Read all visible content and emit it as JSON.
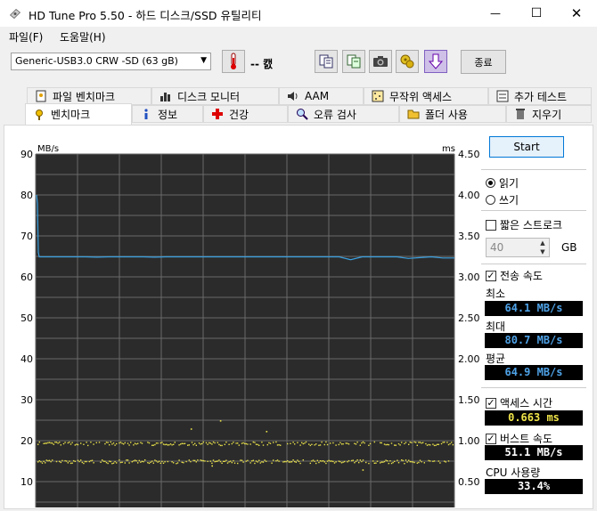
{
  "window": {
    "title": "HD Tune Pro 5.50 - 하드 디스크/SSD 유틸리티",
    "minimize": "—",
    "maximize": "☐",
    "close": "✕"
  },
  "menu": {
    "file": "파일(F)",
    "help": "도움말(H)"
  },
  "toolbar": {
    "drive": "Generic-USB3.0 CRW  -SD (63 gB)",
    "temperature": "-- 캜",
    "exit": "종료"
  },
  "tabs_top": [
    {
      "label": "파일 벤치마크",
      "icon": "file-benchmark-icon"
    },
    {
      "label": "디스크 모니터",
      "icon": "disk-monitor-icon"
    },
    {
      "label": "AAM",
      "icon": "speaker-icon"
    },
    {
      "label": "무작위 액세스",
      "icon": "random-access-icon"
    },
    {
      "label": "추가 테스트",
      "icon": "extra-tests-icon"
    }
  ],
  "tabs_bottom": [
    {
      "label": "벤치마크",
      "icon": "benchmark-icon"
    },
    {
      "label": "정보",
      "icon": "info-icon"
    },
    {
      "label": "건강",
      "icon": "health-icon"
    },
    {
      "label": "오류 검사",
      "icon": "error-scan-icon"
    },
    {
      "label": "폴더 사용",
      "icon": "folder-usage-icon"
    },
    {
      "label": "지우기",
      "icon": "erase-icon"
    }
  ],
  "panel": {
    "start": "Start",
    "read": "읽기",
    "write": "쓰기",
    "short_stroke": "짧은 스트로크",
    "stroke_value": "40",
    "stroke_unit": "GB",
    "transfer_rate": "전송 속도",
    "minimum_label": "최소",
    "minimum": "64.1 MB/s",
    "maximum_label": "최대",
    "maximum": "80.7 MB/s",
    "average_label": "평균",
    "average": "64.9 MB/s",
    "access_time_label": "액세스 시간",
    "access_time": "0.663 ms",
    "burst_rate_label": "버스트 속도",
    "burst_rate": "51.1 MB/s",
    "cpu_label": "CPU 사용량",
    "cpu": "33.4%"
  },
  "chart_data": {
    "type": "line",
    "y_left_label": "MB/s",
    "y_right_label": "ms",
    "y_left_ticks": [
      "90",
      "80",
      "70",
      "60",
      "50",
      "40",
      "30",
      "20",
      "10"
    ],
    "y_right_ticks": [
      "4.50",
      "4.00",
      "3.50",
      "3.00",
      "2.50",
      "2.00",
      "1.50",
      "1.00",
      "0.50"
    ],
    "ylim_left": [
      0,
      90
    ],
    "ylim_right": [
      0,
      4.5
    ],
    "grid": true,
    "series": [
      {
        "values": [
          80,
          78,
          66,
          64.9,
          64.9,
          64.9,
          64.9,
          64.9,
          64.8,
          64.9,
          64.9,
          64.9,
          64.9,
          64.8,
          64.9,
          64.9,
          64.9,
          64.9,
          64.9,
          64.9,
          64.9,
          64.9,
          64.9,
          64.9,
          64.9,
          64.9,
          64.9,
          64.9,
          64.9,
          64.9,
          64.2,
          64.9,
          64.9,
          64.9,
          64.9,
          64.5,
          64.7,
          64.9,
          64.6,
          64.6
        ],
        "color": "#3aa0e0"
      }
    ],
    "access_points": {
      "color": "#e8e04a",
      "bands_ms": [
        0.75,
        0.97
      ],
      "outliers": [
        [
          0.44,
          1.25
        ],
        [
          0.37,
          1.15
        ],
        [
          0.55,
          1.12
        ],
        [
          0.42,
          0.7
        ],
        [
          0.78,
          0.65
        ]
      ]
    }
  }
}
